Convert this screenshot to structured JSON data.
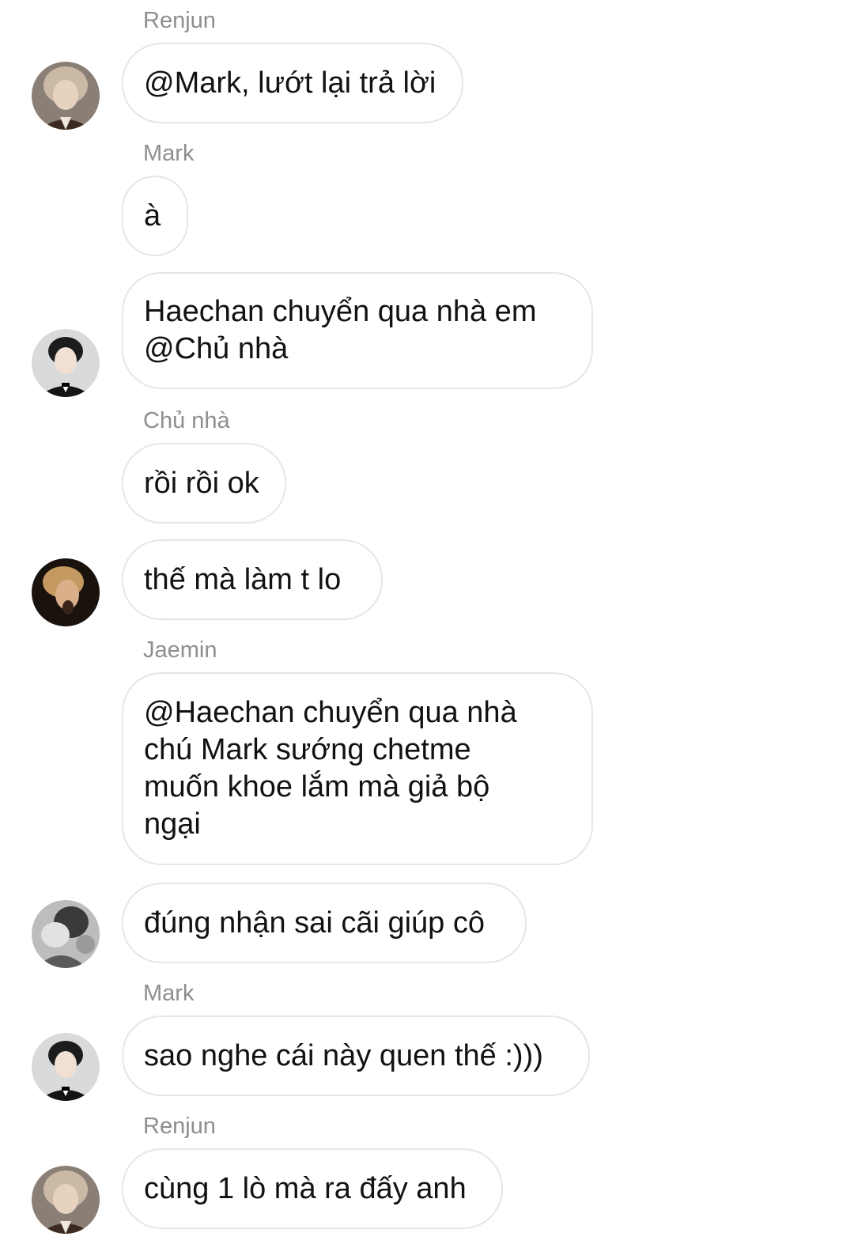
{
  "messages": [
    {
      "sender": "Renjun",
      "text": "@Mark, lướt lại trả lời"
    },
    {
      "sender": "Mark",
      "text": "à"
    },
    {
      "sender": "",
      "text": "Haechan chuyển qua nhà em\n@Chủ nhà"
    },
    {
      "sender": "Chủ nhà",
      "text": "rồi rồi ok"
    },
    {
      "sender": "",
      "text": "thế mà làm t lo"
    },
    {
      "sender": "Jaemin",
      "text": "@Haechan chuyển qua nhà\nchú Mark sướng chetme\nmuốn khoe lắm mà giả bộ\nngại"
    },
    {
      "sender": "",
      "text": "đúng nhận sai cãi giúp cô"
    },
    {
      "sender": "Mark",
      "text": "sao nghe cái này quen thế :)))"
    },
    {
      "sender": "Renjun",
      "text": "cùng 1 lò mà ra đấy anh"
    }
  ],
  "colors": {
    "sender_name": "#8e8e8e",
    "bubble_border": "#e6e6e6",
    "message_text": "#121212",
    "background": "#ffffff"
  }
}
